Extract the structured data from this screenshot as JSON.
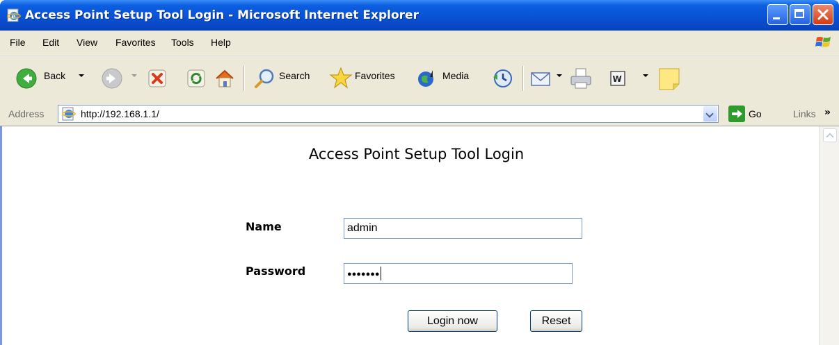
{
  "window": {
    "title": "Access Point Setup Tool Login - Microsoft Internet Explorer"
  },
  "menu": {
    "items": [
      "File",
      "Edit",
      "View",
      "Favorites",
      "Tools",
      "Help"
    ]
  },
  "toolbar": {
    "back_label": "Back",
    "search_label": "Search",
    "favorites_label": "Favorites",
    "media_label": "Media"
  },
  "addressbar": {
    "label": "Address",
    "url": "http://192.168.1.1/",
    "go_label": "Go",
    "links_label": "Links",
    "links_chevron": "»"
  },
  "page": {
    "title": "Access Point Setup Tool Login",
    "name_label": "Name",
    "name_value": "admin",
    "password_label": "Password",
    "password_value": "●●●●●●●",
    "login_button": "Login now",
    "reset_button": "Reset"
  },
  "colors": {
    "titlebar": "#0a52d6",
    "chrome": "#ece9d8",
    "input_border": "#7f9db9",
    "close_button": "#d23b14"
  },
  "icons": [
    "ie-page-icon",
    "windows-flag-icon",
    "back-arrow-icon",
    "forward-arrow-icon",
    "stop-icon",
    "refresh-icon",
    "home-icon",
    "search-icon",
    "favorites-star-icon",
    "media-icon",
    "history-icon",
    "mail-icon",
    "print-icon",
    "word-icon",
    "notes-icon",
    "go-arrow-icon"
  ]
}
